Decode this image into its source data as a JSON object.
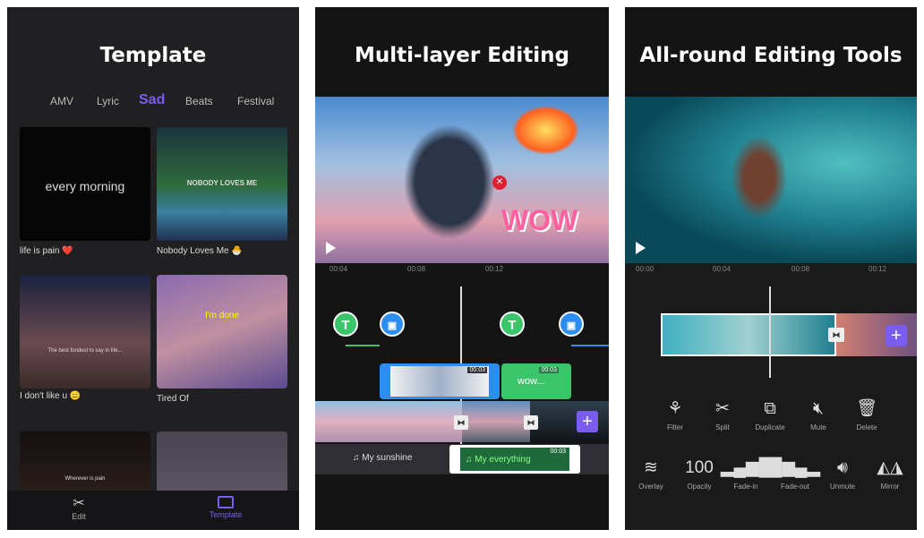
{
  "panels": [
    {
      "title": "Template",
      "tabs": [
        "AMV",
        "Lyric",
        "Sad",
        "Beats",
        "Festival"
      ],
      "active_tab": "Sad",
      "cards": [
        {
          "label": "life is pain ❤️",
          "overlay": "every morning"
        },
        {
          "label": "Nobody Loves Me 🐣",
          "overlay": "NOBODY LOVES ME"
        },
        {
          "label": "I don't like u 😑",
          "overlay": "The best fondest to say in life..."
        },
        {
          "label": "Tired Of",
          "overlay": "I'm done"
        },
        {
          "label": "",
          "overlay": "Wherever is pain"
        },
        {
          "label": "",
          "overlay": ""
        }
      ],
      "nav": [
        {
          "label": "Edit",
          "icon": "scissors-icon"
        },
        {
          "label": "Template",
          "icon": "template-icon",
          "active": true
        }
      ]
    },
    {
      "title": "Multi-layer Editing",
      "video_overlay": "WOW",
      "ruler": [
        "00:04",
        "00:08",
        "00:12"
      ],
      "clip_times": [
        "00:03",
        "00:03",
        "00:03"
      ],
      "text_clip": "wow...",
      "audio": [
        "My sunshine",
        "My everything"
      ]
    },
    {
      "title": "All-round Editing Tools",
      "ruler": [
        "00:00",
        "00:04",
        "00:08",
        "00:12"
      ],
      "tools_row1": [
        {
          "label": "Filter",
          "icon": "filter-icon"
        },
        {
          "label": "Split",
          "icon": "scissors-icon"
        },
        {
          "label": "Duplicate",
          "icon": "duplicate-icon"
        },
        {
          "label": "Mute",
          "icon": "mute-icon"
        },
        {
          "label": "Delete",
          "icon": "trash-icon"
        }
      ],
      "tools_row2": [
        {
          "label": "Overlay",
          "icon": "layers-icon"
        },
        {
          "label": "Opacity",
          "value": "100"
        },
        {
          "label": "Fade-in",
          "icon": "fade-in-icon"
        },
        {
          "label": "Fade-out",
          "icon": "fade-out-icon"
        },
        {
          "label": "Unmute",
          "icon": "volume-icon"
        },
        {
          "label": "Mirror",
          "icon": "mirror-icon"
        }
      ]
    }
  ],
  "colors": {
    "accent": "#7b5cf0",
    "green": "#3cc46a",
    "blue": "#2b8ef0"
  }
}
